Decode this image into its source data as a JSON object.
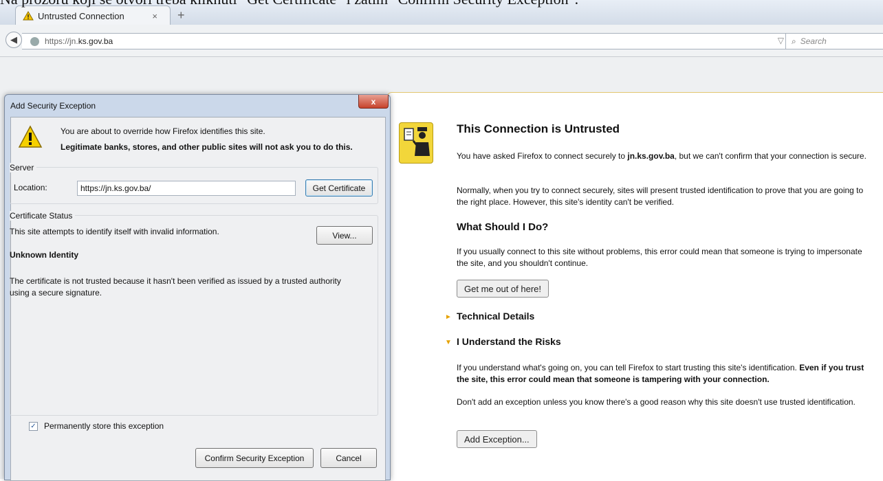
{
  "caption": "Na prozoru koji se otvori treba kliknuti \"Get Certificate\" i zatim \"Confirm Security Exception\".",
  "browser": {
    "tab_title": "Untrusted Connection",
    "tab_close": "×",
    "new_tab": "+",
    "url_prefix": "https://jn.",
    "url_domain": "ks.gov.ba",
    "url_right": "▽ C",
    "search_placeholder": "Search"
  },
  "page": {
    "title": "This Connection is Untrusted",
    "p1_before": "You have asked Firefox to connect securely to ",
    "p1_host": "jn.ks.gov.ba",
    "p1_after": ", but we can't confirm that your connection is secure.",
    "p2": "Normally, when you try to connect securely, sites will present trusted identification to prove that you are going to the right place. However, this site's identity can't be verified.",
    "what_heading": "What Should I Do?",
    "p3": "If you usually connect to this site without problems, this error could mean that someone is trying to impersonate the site, and you shouldn't continue.",
    "get_out_button": "Get me out of here!",
    "technical_details": "Technical Details",
    "understand_risks": "I Understand the Risks",
    "p4_before": "If you understand what's going on, you can tell Firefox to start trusting this site's identification. ",
    "p4_bold": "Even if you trust the site, this error could mean that someone is tampering with your connection.",
    "p5": "Don't add an exception unless you know there's a good reason why this site doesn't use trusted identification.",
    "add_exception_button": "Add Exception..."
  },
  "dialog": {
    "title": "Add Security Exception",
    "close": "x",
    "warn_line1": "You are about to override how Firefox identifies this site.",
    "warn_line2": "Legitimate banks, stores, and other public sites will not ask you to do this.",
    "server_label": "Server",
    "location_label": "Location:",
    "location_value": "https://jn.ks.gov.ba/",
    "get_certificate_button": "Get Certificate",
    "cert_status_label": "Certificate Status",
    "cert_status_text": "This site attempts to identify itself with invalid information.",
    "view_button": "View...",
    "unknown_identity": "Unknown Identity",
    "cert_detail": "The certificate is not trusted because it hasn't been verified as issued by a trusted authority using a secure signature.",
    "permanently_store": "Permanently store this exception",
    "checkbox_checked": "✓",
    "confirm_button": "Confirm Security Exception",
    "cancel_button": "Cancel"
  }
}
